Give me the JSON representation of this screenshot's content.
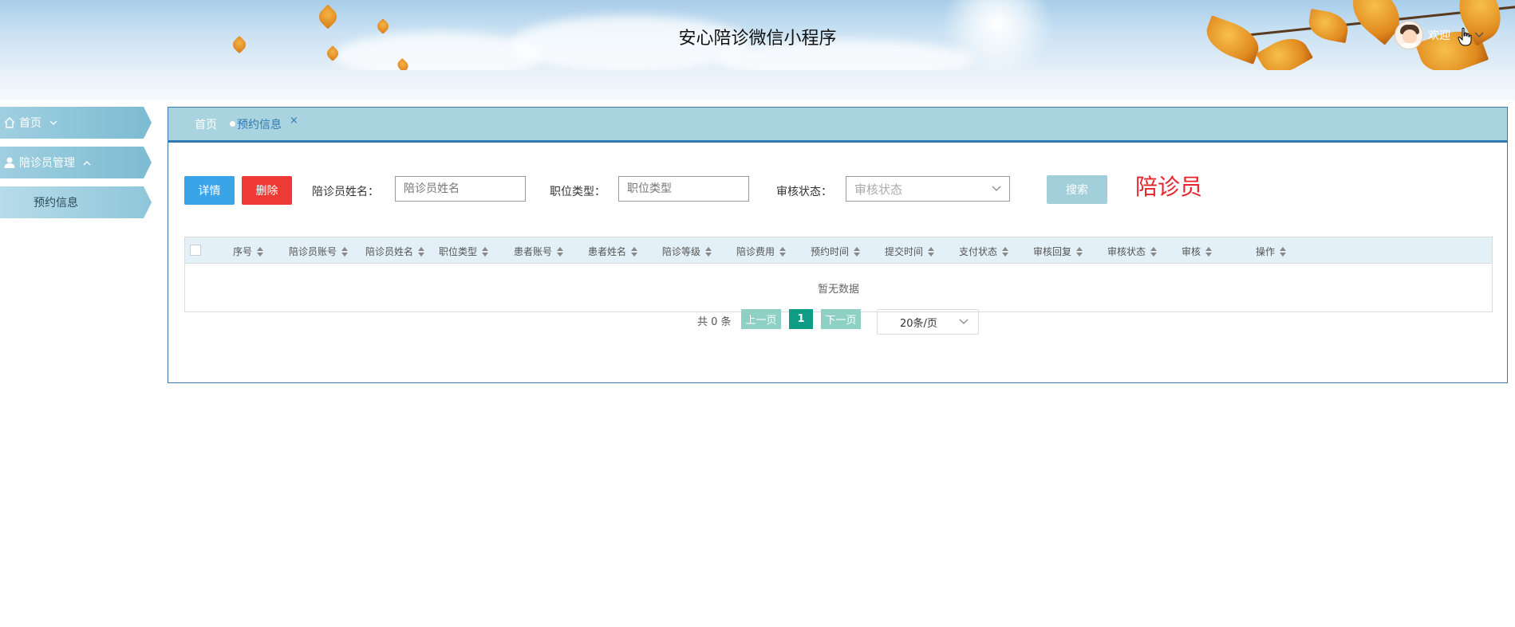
{
  "header": {
    "title": "安心陪诊微信小程序",
    "welcome": "欢迎",
    "user_menu_icon": "chevron-down-icon"
  },
  "sidebar": {
    "items": [
      {
        "label": "首页",
        "icon": "home-icon",
        "expanded": false
      },
      {
        "label": "陪诊员管理",
        "icon": "user-icon",
        "expanded": true
      },
      {
        "label": "预约信息",
        "sub": true
      }
    ]
  },
  "tabs": {
    "home": "首页",
    "current": "预约信息",
    "close": "×"
  },
  "toolbar": {
    "detail_label": "详情",
    "delete_label": "删除",
    "search_label": "搜索",
    "role_label": "陪诊员"
  },
  "filters": {
    "name_label": "陪诊员姓名：",
    "name_placeholder": "陪诊员姓名",
    "position_label": "职位类型：",
    "position_placeholder": "职位类型",
    "status_label": "审核状态：",
    "status_placeholder": "审核状态"
  },
  "table": {
    "columns": [
      "序号",
      "陪诊员账号",
      "陪诊员姓名",
      "职位类型",
      "患者账号",
      "患者姓名",
      "陪诊等级",
      "陪诊费用",
      "预约时间",
      "提交时间",
      "支付状态",
      "审核回复",
      "审核状态",
      "审核",
      "操作"
    ],
    "empty_text": "暂无数据"
  },
  "pagination": {
    "total_text": "共 0 条",
    "prev": "上一页",
    "current_page": "1",
    "next": "下一页",
    "page_size": "20条/页"
  },
  "colors": {
    "accent": "#2f79b5",
    "tab_bar": "#a9d3df",
    "detail_button": "#3aa4e8",
    "delete_button": "#ee3a34",
    "search_button": "#a3cfdb",
    "pager_active": "#0e9c86",
    "pager_inactive": "#8fd0c4",
    "role_label": "#e8242a"
  }
}
